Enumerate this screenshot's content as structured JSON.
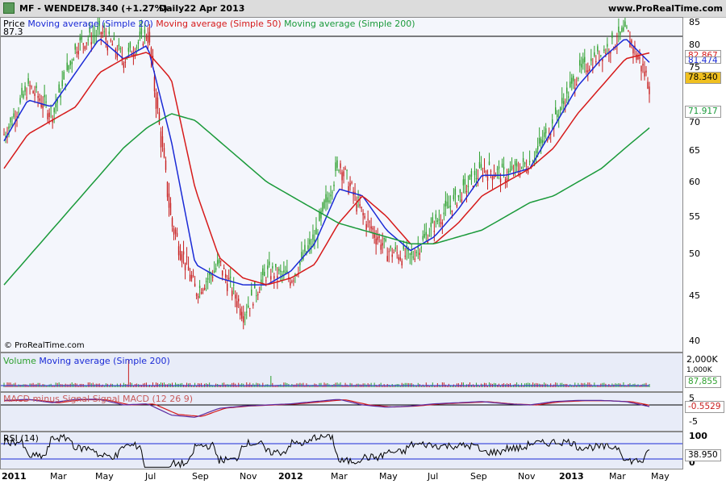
{
  "header": {
    "symbol": "MF - WENDEL",
    "price": "78.340 (+1.27%)",
    "period": "Daily",
    "date": "22 Apr 2013",
    "brand": "www.ProRealTime.com"
  },
  "price_panel": {
    "labels": [
      "Price",
      "Moving average (Simple 20)",
      "Moving average (Simple 50)",
      "Moving average (Simple 200)"
    ],
    "high_label": "87.3",
    "watermark": "© ProRealTime.com",
    "y_ticks": [
      "85",
      "80",
      "75",
      "70",
      "65",
      "60",
      "55",
      "50",
      "45",
      "40"
    ],
    "tags": {
      "ma50": "82.867",
      "ma20": "81.474",
      "price": "78.340",
      "ma200": "71.917"
    }
  },
  "volume_panel": {
    "labels": [
      "Volume",
      "Moving average (Simple 200)"
    ],
    "y_ticks": [
      "2,000K",
      "1,000K"
    ],
    "tag": "87,855"
  },
  "macd_panel": {
    "label": "MACD minus Signal Signal MACD (12 26 9)",
    "y_ticks": [
      "5",
      "0",
      "-5"
    ],
    "tag": "-0.5529"
  },
  "rsi_panel": {
    "label": "RSI (14)",
    "y_ticks": [
      "100",
      "0"
    ],
    "tag": "38.950"
  },
  "x_labels": [
    "2011",
    "Mar",
    "May",
    "Jul",
    "Sep",
    "Nov",
    "2012",
    "Mar",
    "May",
    "Jul",
    "Sep",
    "Nov",
    "2013",
    "Mar",
    "May"
  ],
  "colors": {
    "ma20": "#1a2ad6",
    "ma50": "#d61a1a",
    "ma200": "#1a9a3a",
    "up": "#2ea02e",
    "down": "#c81e1e"
  },
  "chart_data": {
    "type": "line",
    "x": [
      "2011-01",
      "2011-02",
      "2011-03",
      "2011-04",
      "2011-05",
      "2011-06",
      "2011-07",
      "2011-08",
      "2011-09",
      "2011-10",
      "2011-11",
      "2011-12",
      "2012-01",
      "2012-02",
      "2012-03",
      "2012-04",
      "2012-05",
      "2012-06",
      "2012-07",
      "2012-08",
      "2012-09",
      "2012-10",
      "2012-11",
      "2012-12",
      "2013-01",
      "2013-02",
      "2013-03",
      "2013-04"
    ],
    "series": [
      {
        "name": "Price",
        "values": [
          71,
          78,
          74,
          84,
          86,
          82,
          86,
          58,
          48,
          52,
          45,
          51,
          50,
          56,
          67,
          59,
          54,
          53,
          58,
          62,
          66,
          65,
          67,
          73,
          80,
          83,
          86,
          78.34
        ]
      },
      {
        "name": "Moving average (Simple 20)",
        "values": [
          70,
          76,
          75,
          80,
          85,
          82,
          84,
          70,
          52,
          50,
          49,
          49,
          51,
          55,
          63,
          62,
          57,
          54,
          56,
          60,
          65,
          65,
          66,
          72,
          78,
          82,
          85,
          81.47
        ]
      },
      {
        "name": "Moving average (Simple 50)",
        "values": [
          66,
          71,
          73,
          75,
          80,
          82,
          83,
          79,
          63,
          53,
          50,
          49,
          50,
          52,
          58,
          62,
          59,
          55,
          55,
          58,
          62,
          64,
          66,
          69,
          74,
          78,
          82,
          82.87
        ]
      },
      {
        "name": "Moving average (Simple 200)",
        "values": [
          49,
          53,
          57,
          61,
          65,
          69,
          72,
          74,
          73,
          70,
          67,
          64,
          62,
          60,
          58,
          57,
          56,
          55,
          55,
          56,
          57,
          59,
          61,
          62,
          64,
          66,
          69,
          71.92
        ]
      }
    ],
    "ylim": [
      39,
      88
    ],
    "grid": false
  }
}
